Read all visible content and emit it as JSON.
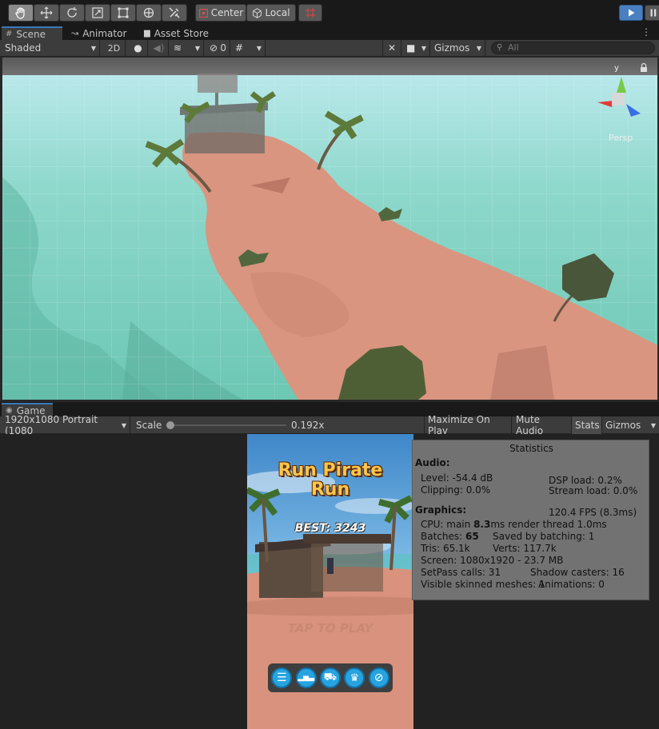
{
  "topbar": {
    "center_label": "Center",
    "local_label": "Local",
    "tools": [
      "hand-tool",
      "move-tool",
      "rotate-tool",
      "scale-tool",
      "rect-tool",
      "transform-tool",
      "custom-tool"
    ]
  },
  "tabs": [
    {
      "label": "Scene",
      "icon": "grid-icon",
      "selected": true
    },
    {
      "label": "Animator",
      "icon": "animator-icon",
      "selected": false
    },
    {
      "label": "Asset Store",
      "icon": "store-icon",
      "selected": false
    }
  ],
  "scene_toolbar": {
    "shading_mode": "Shaded",
    "mode_2d": "2D",
    "hidden_count": "0",
    "gizmos_label": "Gizmos",
    "search_placeholder": "All"
  },
  "scene_gizmo": {
    "y_label": "y",
    "persp_label": "Persp"
  },
  "game_tab": {
    "label": "Game"
  },
  "game_toolbar": {
    "resolution": "1920x1080 Portrait (1080",
    "scale_label": "Scale",
    "scale_value": "0.192x",
    "maximize_label": "Maximize On Play",
    "mute_label": "Mute Audio",
    "stats_label": "Stats",
    "gizmos_label": "Gizmos"
  },
  "game_view": {
    "title_line1": "Run Pirate",
    "title_line2": "Run",
    "best": "BEST: 3243",
    "tap_to_play": "TAP TO PLAY",
    "buttons": [
      "menu-icon",
      "leaderboard-icon",
      "cart-icon",
      "trophy-icon",
      "no-ads-icon"
    ]
  },
  "stats": {
    "title": "Statistics",
    "audio_heading": "Audio:",
    "level": "Level: -54.4 dB",
    "clipping": "Clipping: 0.0%",
    "dsp_load": "DSP load: 0.2%",
    "stream_load": "Stream load: 0.0%",
    "graphics_heading": "Graphics:",
    "fps": "120.4 FPS (8.3ms)",
    "cpu_prefix": "CPU: main ",
    "cpu_main": "8.3",
    "cpu_suffix": "ms  render thread 1.0ms",
    "batches_prefix": "Batches: ",
    "batches": "65",
    "saved_batching": "Saved by batching: 1",
    "tris": "Tris: 65.1k",
    "verts": "Verts: 117.7k",
    "screen": "Screen: 1080x1920 - 23.7 MB",
    "setpass": "SetPass calls: 31",
    "shadow_casters": "Shadow casters: 16",
    "skinned": "Visible skinned meshes: 1",
    "animations": "Animations: 0"
  },
  "colors": {
    "accent": "#3a79bb",
    "play_button": "#4a7fc1",
    "sand": "#d9957f",
    "water": "#8fd6c6"
  }
}
